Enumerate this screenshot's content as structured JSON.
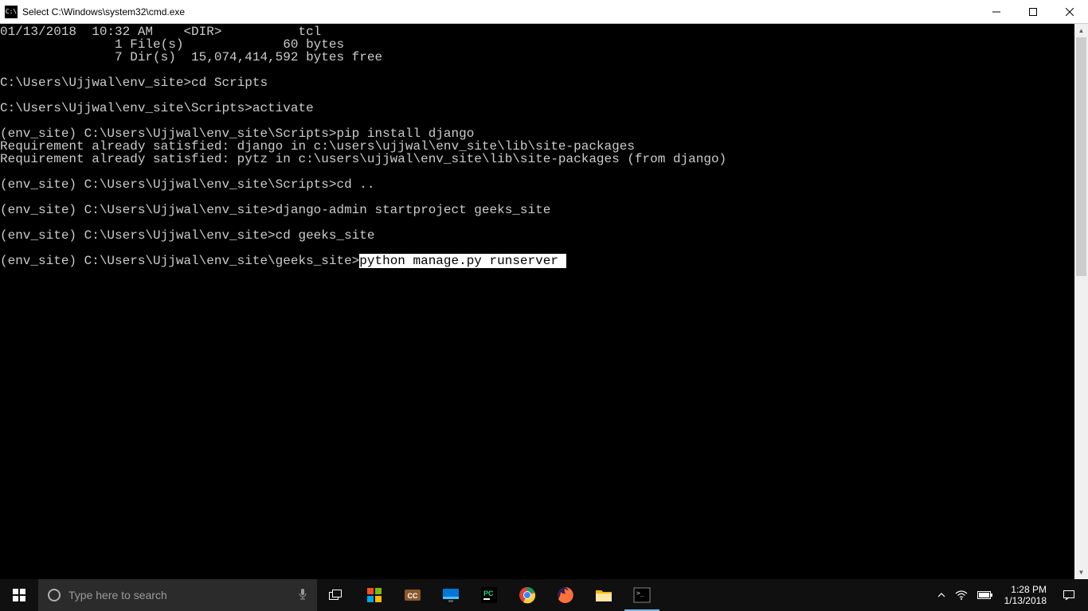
{
  "window": {
    "title": "Select C:\\Windows\\system32\\cmd.exe",
    "icon_label": "C:\\"
  },
  "terminal": {
    "lines": [
      "01/13/2018  10:32 AM    <DIR>          tcl",
      "               1 File(s)             60 bytes",
      "               7 Dir(s)  15,074,414,592 bytes free",
      "",
      "C:\\Users\\Ujjwal\\env_site>cd Scripts",
      "",
      "C:\\Users\\Ujjwal\\env_site\\Scripts>activate",
      "",
      "(env_site) C:\\Users\\Ujjwal\\env_site\\Scripts>pip install django",
      "Requirement already satisfied: django in c:\\users\\ujjwal\\env_site\\lib\\site-packages",
      "Requirement already satisfied: pytz in c:\\users\\ujjwal\\env_site\\lib\\site-packages (from django)",
      "",
      "(env_site) C:\\Users\\Ujjwal\\env_site\\Scripts>cd ..",
      "",
      "(env_site) C:\\Users\\Ujjwal\\env_site>django-admin startproject geeks_site",
      "",
      "(env_site) C:\\Users\\Ujjwal\\env_site>cd geeks_site",
      ""
    ],
    "current_prompt": "(env_site) C:\\Users\\Ujjwal\\env_site\\geeks_site>",
    "current_input_selected": "python manage.py runserver"
  },
  "taskbar": {
    "search_placeholder": "Type here to search",
    "apps": [
      {
        "name": "microsoft-store-icon",
        "color1": "#f25022",
        "color2": "#7fba00",
        "color3": "#00a4ef",
        "color4": "#ffb900"
      },
      {
        "name": "captions-icon"
      },
      {
        "name": "explorer-desktop-icon"
      },
      {
        "name": "pycharm-icon"
      },
      {
        "name": "chrome-icon"
      },
      {
        "name": "firefox-icon"
      },
      {
        "name": "file-explorer-icon"
      },
      {
        "name": "cmd-icon",
        "active": true
      }
    ],
    "time": "1:28 PM",
    "date": "1/13/2018"
  }
}
